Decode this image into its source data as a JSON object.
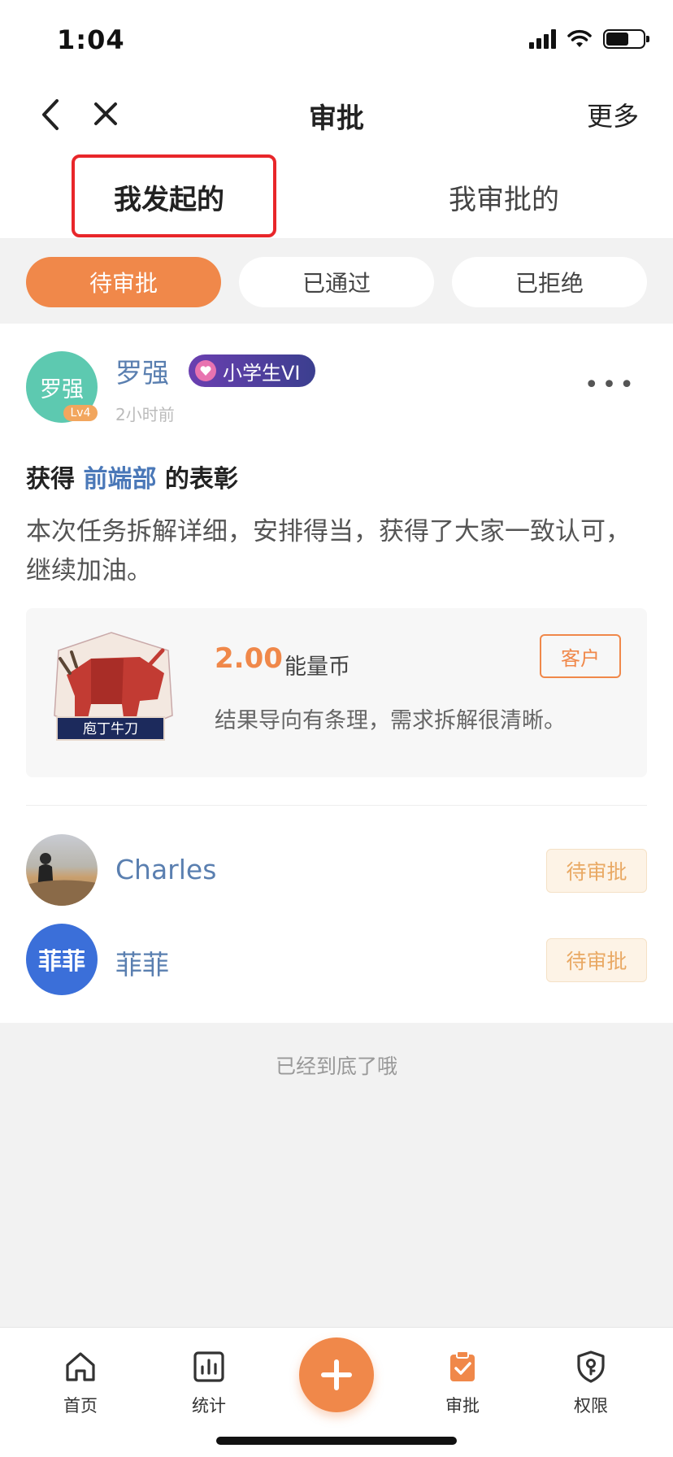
{
  "status_bar": {
    "time": "1:04"
  },
  "nav": {
    "title": "审批",
    "more": "更多"
  },
  "tabs": [
    {
      "label": "我发起的",
      "active": true
    },
    {
      "label": "我审批的",
      "active": false
    }
  ],
  "filters": [
    {
      "label": "待审批",
      "active": true
    },
    {
      "label": "已通过",
      "active": false
    },
    {
      "label": "已拒绝",
      "active": false
    }
  ],
  "post": {
    "avatar_text": "罗强",
    "level": "Lv4",
    "user_name": "罗强",
    "badge": "小学生VI",
    "time": "2小时前",
    "praise_prefix": "获得",
    "praise_dept": "前端部",
    "praise_suffix": "的表彰",
    "content": "本次任务拆解详细，安排得当，获得了大家一致认可，继续加油。",
    "reward": {
      "image_label": "庖丁牛刀",
      "amount": "2.00",
      "unit": "能量币",
      "tag": "客户",
      "description": "结果导向有条理，需求拆解很清晰。"
    }
  },
  "approvers": [
    {
      "name": "Charles",
      "status": "待审批"
    },
    {
      "avatar_text": "菲菲",
      "name": "菲菲",
      "status": "待审批"
    }
  ],
  "end_text": "已经到底了哦",
  "tabbar": [
    {
      "label": "首页",
      "icon": "home-icon"
    },
    {
      "label": "统计",
      "icon": "stats-icon"
    },
    {
      "label": "",
      "icon": "plus-icon"
    },
    {
      "label": "审批",
      "icon": "approval-clipboard-icon",
      "active": true
    },
    {
      "label": "权限",
      "icon": "shield-key-icon"
    }
  ],
  "colors": {
    "accent": "#f0884a",
    "link": "#5a7fb0",
    "highlight_box": "#e8262a"
  }
}
